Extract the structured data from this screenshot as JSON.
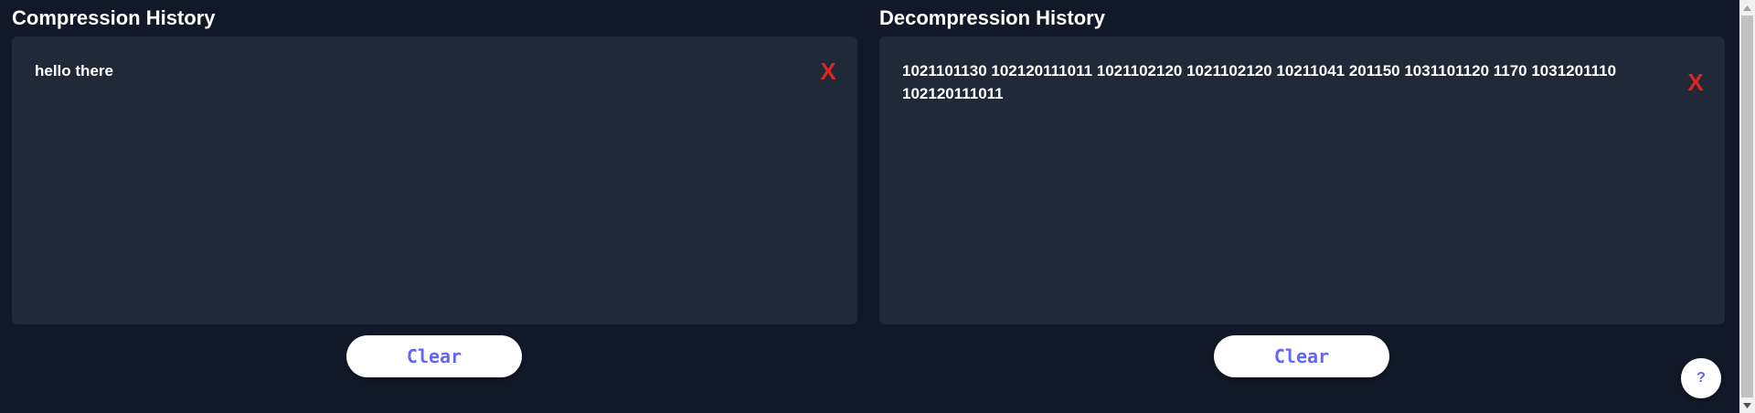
{
  "compression": {
    "title": "Compression History",
    "entries": [
      "hello there"
    ],
    "remove_label": "X",
    "clear_label": "Clear"
  },
  "decompression": {
    "title": "Decompression History",
    "entries": [
      "1021101130 102120111011 1021102120 1021102120 10211041 201150 1031101120 1170 1031201110 102120111011"
    ],
    "remove_label": "X",
    "clear_label": "Clear"
  },
  "help_label": "?",
  "colors": {
    "page_background": "#111827",
    "panel_background": "#1f2937",
    "remove_icon": "#dc2626",
    "button_text": "#6366f1",
    "button_background": "#ffffff"
  }
}
